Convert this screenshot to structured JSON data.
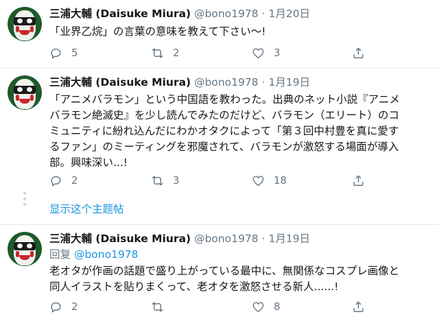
{
  "tweets": [
    {
      "name": "三浦大輔 (Daisuke Miura)",
      "handle": "@bono1978",
      "separator": "·",
      "date": "1月20日",
      "text": "「业界乙烷」の言葉の意味を教えて下さい〜!",
      "reply_count": "5",
      "retweet_count": "2",
      "like_count": "3"
    },
    {
      "name": "三浦大輔 (Daisuke Miura)",
      "handle": "@bono1978",
      "separator": "·",
      "date": "1月19日",
      "text": "「アニメバラモン」という中国語を教わった。出典のネット小説『アニメ\nバラモン絶滅史』を少し読んでみたのだけど、バラモン（エリート）のコ\nミュニティに紛れ込んだにわかオタクによって「第３回中村豊を真に愛す\nるファン」のミーティングを邪魔されて、バラモンが激怒する場面が導入\n部。興味深い...!",
      "reply_count": "2",
      "retweet_count": "3",
      "like_count": "18"
    },
    {
      "name": "三浦大輔 (Daisuke Miura)",
      "handle": "@bono1978",
      "separator": "·",
      "date": "1月19日",
      "reply_prefix": "回复",
      "reply_mention": "@bono1978",
      "text": "老オタが作画の話題で盛り上がっている最中に、無関係なコスプレ画像と\n同人イラストを貼りまくって、老オタを激怒させる新人......!",
      "reply_count": "2",
      "retweet_count": "",
      "like_count": "8"
    }
  ],
  "show_thread_label": "显示这个主题帖",
  "colors": {
    "text": "#14171a",
    "secondary": "#657786",
    "link": "#1b95e0",
    "divider": "#e1e8ed"
  },
  "icons": [
    "reply-icon",
    "retweet-icon",
    "like-icon",
    "share-icon"
  ]
}
